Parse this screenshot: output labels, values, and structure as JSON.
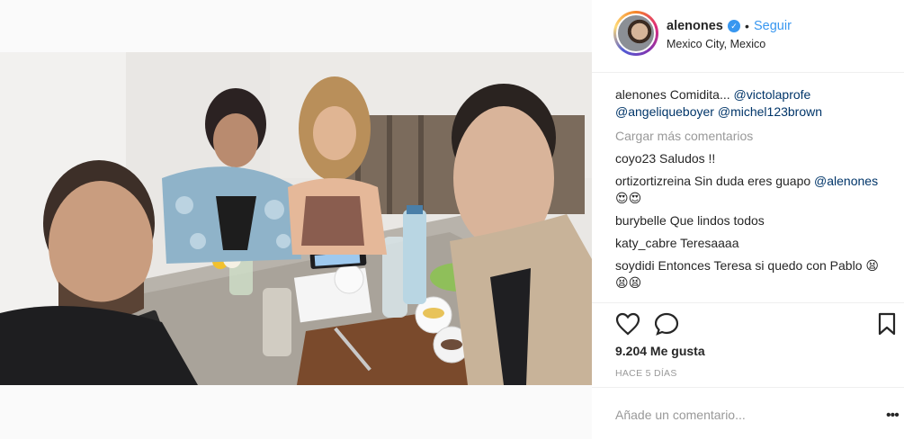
{
  "post": {
    "username": "alenones",
    "follow_label": "Seguir",
    "location": "Mexico City, Mexico",
    "separator": "•",
    "verified_icon": "verified-badge-icon"
  },
  "caption": {
    "username": "alenones",
    "text": "Comidita...",
    "mentions": [
      "@victolaprofe",
      "@angeliqueboyer",
      "@michel123brown"
    ]
  },
  "load_more_label": "Cargar más comentarios",
  "comments": [
    {
      "user": "coyo23",
      "text": "Saludos !!",
      "mention": ""
    },
    {
      "user": "ortizortizreina",
      "text": "Sin duda eres guapo",
      "mention": "@alenones",
      "emoji": "😍😍"
    },
    {
      "user": "burybelle",
      "text": "Que lindos todos",
      "mention": ""
    },
    {
      "user": "katy_cabre",
      "text": "Teresaaaa",
      "mention": ""
    },
    {
      "user": "soydidi",
      "text": "Entonces Teresa si quedo con Pablo",
      "mention": "",
      "emoji": "😫😫😫"
    }
  ],
  "likes_label": "9.204 Me gusta",
  "time_label": "HACE 5 DÍAS",
  "add_comment_placeholder": "Añade un comentario...",
  "more_options": "•••",
  "colors": {
    "link_blue": "#3897f0",
    "mention_blue": "#003569",
    "muted": "#999999",
    "text": "#262626"
  }
}
